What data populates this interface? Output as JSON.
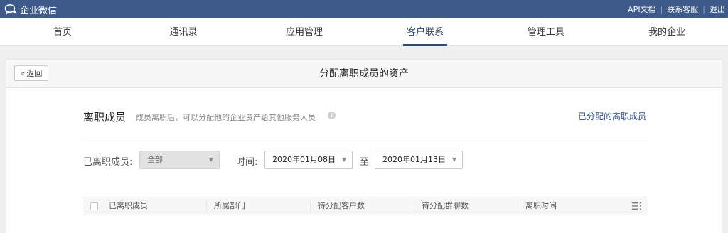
{
  "topbar": {
    "app_name": "企业微信",
    "links": [
      "API文档",
      "联系客服",
      "退出"
    ]
  },
  "nav": {
    "items": [
      "首页",
      "通讯录",
      "应用管理",
      "客户联系",
      "管理工具",
      "我的企业"
    ],
    "active": "客户联系"
  },
  "panel": {
    "back_label": "返回",
    "title": "分配离职成员的资产"
  },
  "section": {
    "title": "离职成员",
    "description": "成员离职后，可以分配他的企业资产给其他服务人员",
    "assigned_link": "已分配的离职成员"
  },
  "filters": {
    "member_label": "已离职成员:",
    "member_value": "全部",
    "time_label": "时间:",
    "start_date": "2020年01月08日",
    "range_sep": "至",
    "end_date": "2020年01月13日"
  },
  "table": {
    "columns": [
      "已离职成员",
      "所属部门",
      "待分配客户数",
      "待分配群聊数",
      "离职时间"
    ]
  },
  "colors": {
    "topbar": "#3d5a8a",
    "accent": "#2b4a80"
  }
}
